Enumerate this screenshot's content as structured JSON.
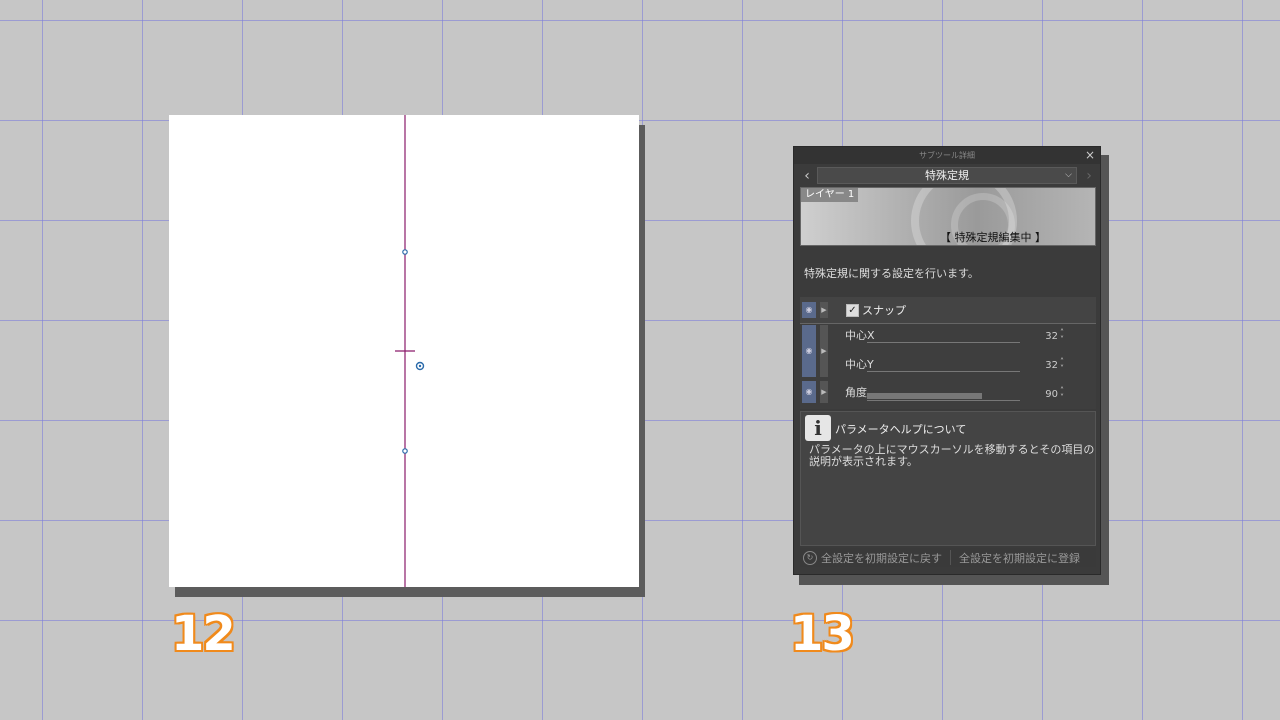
{
  "step_numbers": {
    "left": "12",
    "right": "13"
  },
  "panel": {
    "title": "サブツール詳細",
    "close_icon": "×",
    "nav_left_icon": "‹",
    "nav_right_icon": "›",
    "tool_name": "特殊定規",
    "preview": {
      "layer_tag": "レイヤー 1",
      "editing_label": "【 特殊定規編集中 】"
    },
    "description": "特殊定規に関する設定を行います。",
    "params": {
      "snap_label": "スナップ",
      "snap_checked": true,
      "center_x_label": "中心X",
      "center_x_value": "32",
      "center_y_label": "中心Y",
      "center_y_value": "32",
      "angle_label": "角度",
      "angle_value": "90",
      "angle_fraction": 0.75
    },
    "help": {
      "icon": "i",
      "title": "パラメータヘルプについて",
      "body": "パラメータの上にマウスカーソルを移動するとその項目の説明が表示されます。"
    },
    "footer": {
      "reset_label": "全設定を初期設定に戻す",
      "register_label": "全設定を初期設定に登録"
    }
  },
  "colors": {
    "ruler_line": "#8a1a6a",
    "handle": "#2a6aaa",
    "step_outline": "#f08a1c",
    "grid_line": "#7878dc"
  }
}
